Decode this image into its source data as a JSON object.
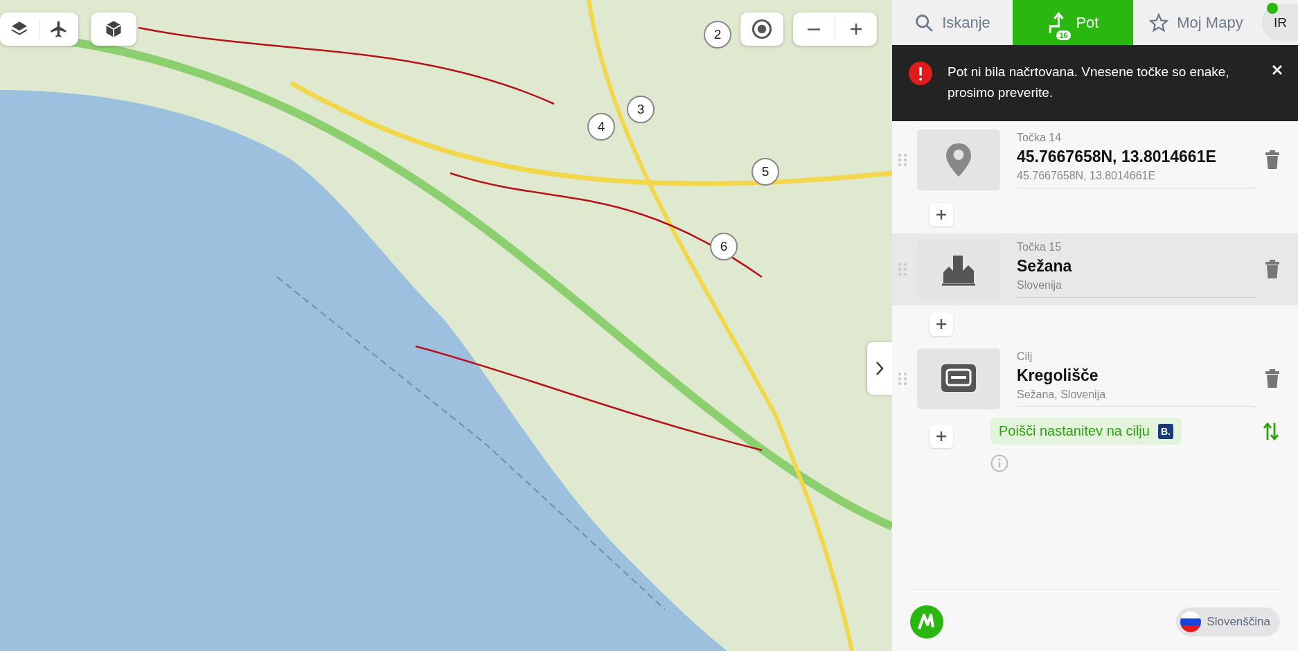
{
  "map": {
    "markers": [
      {
        "label": "2"
      },
      {
        "label": "3"
      },
      {
        "label": "4"
      },
      {
        "label": "5"
      },
      {
        "label": "6"
      }
    ]
  },
  "tabs": [
    {
      "kind": "search",
      "label": "Iskanje",
      "selected": false
    },
    {
      "kind": "route",
      "label": "Pot",
      "badge": "16",
      "selected": true
    },
    {
      "kind": "star",
      "label": "Moj Mapy",
      "selected": false
    }
  ],
  "user": {
    "initials": "IR"
  },
  "toast": {
    "message": "Pot ni bila načrtovana. Vnesene točke so enake, prosimo preverite."
  },
  "waypoints": [
    {
      "kind": "pin",
      "label": "Točka 14",
      "name": "45.7667658N, 13.8014661E",
      "detail": "45.7667658N, 13.8014661E",
      "selected": false
    },
    {
      "kind": "city",
      "label": "Točka 15",
      "name": "Sežana",
      "detail": "Slovenija",
      "selected": true
    },
    {
      "kind": "venue",
      "label": "Cilj",
      "name": "Kregolišče",
      "detail": "Sežana, Slovenija",
      "selected": false
    }
  ],
  "accommodation": {
    "label": "Poišči nastanitev na cilju",
    "badge": "B."
  },
  "language": {
    "label": "Slovenščina"
  }
}
